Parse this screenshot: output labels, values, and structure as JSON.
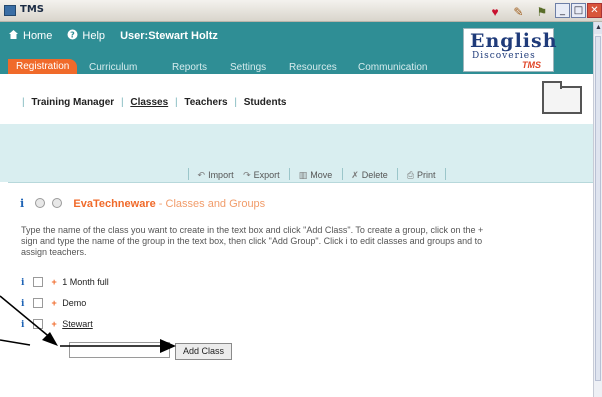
{
  "window": {
    "title": "TMS"
  },
  "topnav": {
    "home": "Home",
    "help": "Help",
    "user": "User:Stewart Holtz"
  },
  "tabs": [
    "Registration",
    "Curriculum",
    "Reports",
    "Settings",
    "Resources",
    "Communication"
  ],
  "logo": {
    "line1": "English",
    "line2": "Discoveries",
    "line3": "TMS"
  },
  "subnav": [
    "Training Manager",
    "Classes",
    "Teachers",
    "Students"
  ],
  "toolbar": {
    "import": "Import",
    "export": "Export",
    "move": "Move",
    "delete": "Delete",
    "print": "Print"
  },
  "section": {
    "org": "EvaTechneware",
    "page": "Classes and Groups"
  },
  "instructions": "Type the name of the class you want to create in the text box and click \"Add Class\". To create a group, click on the + sign and type the name of the group in the text box, then click \"Add Group\". Click i to edit classes and groups and to assign teachers.",
  "classes": [
    "1 Month full",
    "Demo",
    "Stewart"
  ],
  "form": {
    "input_value": "",
    "add_class": "Add Class"
  },
  "info_glyph": "i",
  "plus_glyph": "+",
  "icons": {
    "home": "house-icon",
    "help": "question-icon",
    "folder": "folder-icon"
  },
  "colors": {
    "accent": "#2f8e95",
    "orange": "#f06a2a",
    "band": "#d9eef0"
  }
}
